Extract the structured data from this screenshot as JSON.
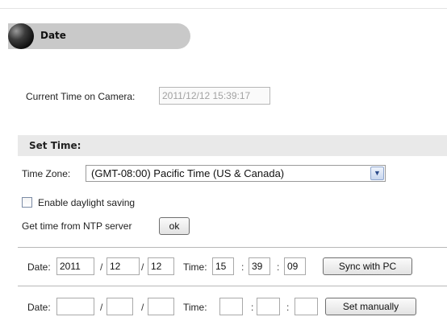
{
  "header": {
    "title": "Date"
  },
  "current_time": {
    "label": "Current Time on Camera:",
    "value": "2011/12/12 15:39:17"
  },
  "set_time": {
    "section_title": "Set Time:",
    "time_zone_label": "Time Zone:",
    "time_zone_value": "(GMT-08:00) Pacific Time (US & Canada)",
    "daylight_label": "Enable daylight saving",
    "daylight_checked": false,
    "ntp_label": "Get time from NTP server",
    "ntp_button": "ok"
  },
  "pc_sync": {
    "date_label": "Date:",
    "year": "2011",
    "month": "12",
    "day": "12",
    "time_label": "Time:",
    "hour": "15",
    "minute": "39",
    "second": "09",
    "button": "Sync with PC"
  },
  "manual": {
    "date_label": "Date:",
    "year": "",
    "month": "",
    "day": "",
    "time_label": "Time:",
    "hour": "",
    "minute": "",
    "second": "",
    "button": "Set manually"
  },
  "separators": {
    "date": "/",
    "time": ":"
  }
}
